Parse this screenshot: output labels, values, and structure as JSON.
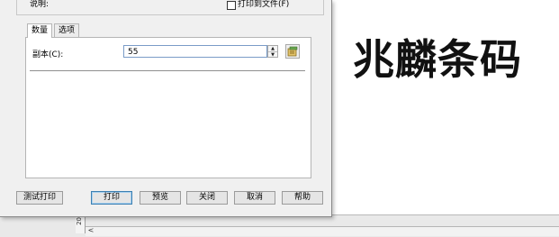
{
  "background": {
    "brand_text": "兆麟条码",
    "ruler_label": "20",
    "scroll_left_arrow": "<"
  },
  "dialog": {
    "description_label": "说明:",
    "print_to_file_label": "打印到文件(F)",
    "print_to_file_checked": false,
    "tabs": [
      {
        "label": "数量",
        "active": true
      },
      {
        "label": "选项",
        "active": false
      }
    ],
    "copies": {
      "label": "副本(C):",
      "value": "55"
    },
    "buttons": {
      "test_print": "测试打印",
      "print": "打印",
      "preview": "预览",
      "close": "关闭",
      "cancel": "取消",
      "help": "帮助"
    }
  },
  "colors": {
    "dialog_bg": "#f0f0f0",
    "default_button_border": "#3c7fb1"
  }
}
